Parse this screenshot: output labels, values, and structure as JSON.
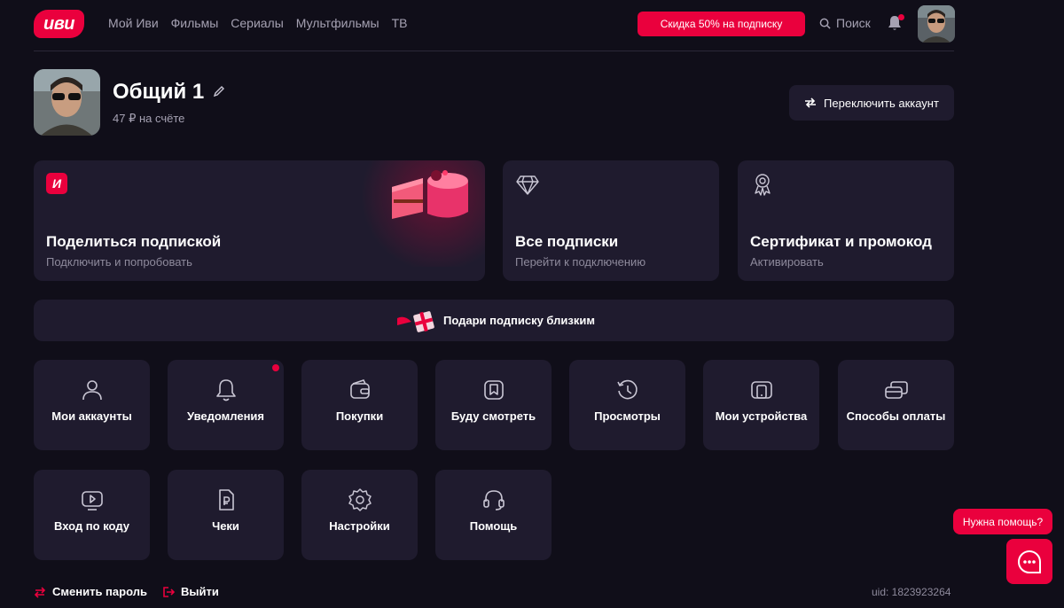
{
  "header": {
    "logo": "иви",
    "nav": [
      "Мой Иви",
      "Фильмы",
      "Сериалы",
      "Мультфильмы",
      "ТВ"
    ],
    "promo_label": "Скидка 50% на подписку",
    "search_label": "Поиск"
  },
  "profile": {
    "name": "Общий 1",
    "balance": "47 ₽ на счёте",
    "switch_label": "Переключить аккаунт"
  },
  "cards": {
    "share": {
      "badge": "И",
      "title": "Поделиться подпиской",
      "subtitle": "Подключить и попробовать"
    },
    "all": {
      "title": "Все подписки",
      "subtitle": "Перейти к подключению"
    },
    "cert": {
      "title": "Сертификат и промокод",
      "subtitle": "Активировать"
    }
  },
  "gift": {
    "label": "Подари подписку близким"
  },
  "tiles": [
    {
      "label": "Мои аккаунты",
      "icon": "user-icon"
    },
    {
      "label": "Уведомления",
      "icon": "bell-icon"
    },
    {
      "label": "Покупки",
      "icon": "wallet-icon"
    },
    {
      "label": "Буду смотреть",
      "icon": "bookmark-icon"
    },
    {
      "label": "Просмотры",
      "icon": "history-icon"
    },
    {
      "label": "Мои устройства",
      "icon": "devices-icon"
    },
    {
      "label": "Способы оплаты",
      "icon": "cards-icon"
    },
    {
      "label": "Вход по коду",
      "icon": "tv-play-icon"
    },
    {
      "label": "Чеки",
      "icon": "receipt-icon"
    },
    {
      "label": "Настройки",
      "icon": "gear-icon"
    },
    {
      "label": "Помощь",
      "icon": "headset-icon"
    }
  ],
  "footer": {
    "change_password": "Сменить пароль",
    "logout": "Выйти",
    "uid": "uid: 1823923264"
  },
  "help": {
    "label": "Нужна помощь?"
  },
  "colors": {
    "accent": "#ea003d",
    "background": "#100e19",
    "surface": "#1f1b2e",
    "muted": "#a5a1b2"
  }
}
